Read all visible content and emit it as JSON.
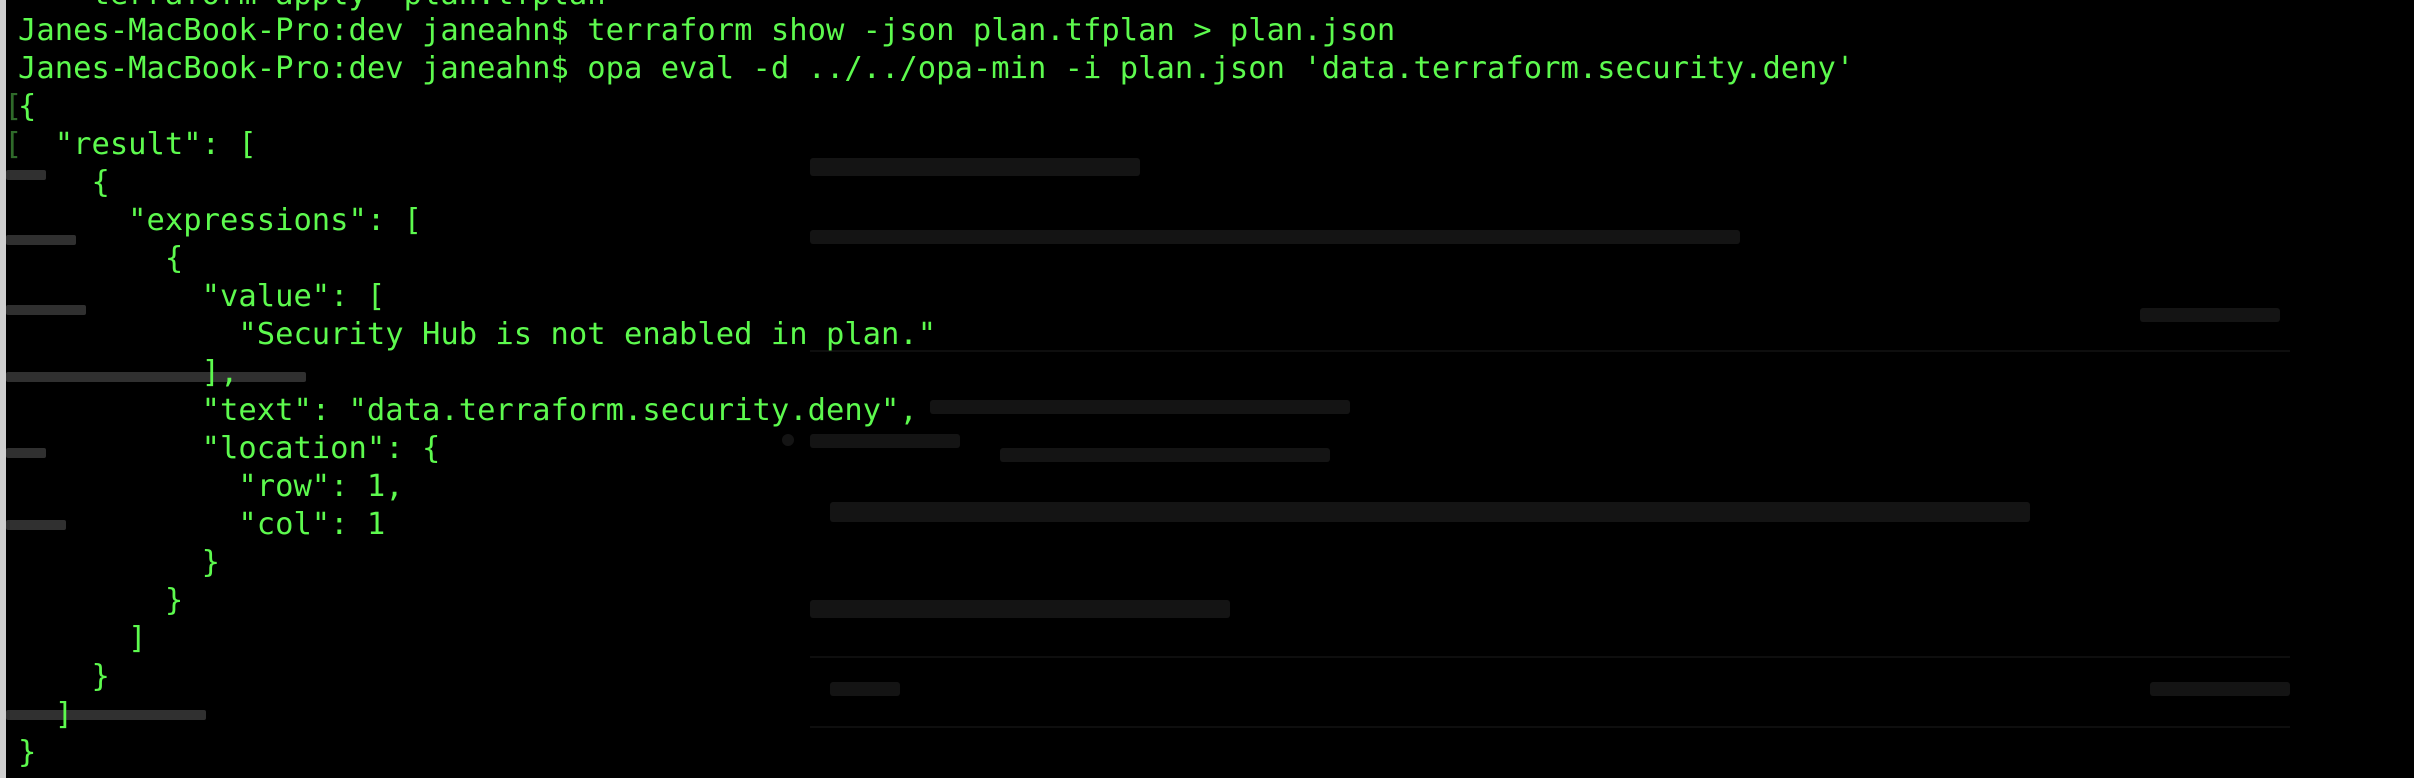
{
  "terminal": {
    "lines": {
      "l0": "    terraform apply \"plan.tfplan\"",
      "l1": "Janes-MacBook-Pro:dev janeahn$ terraform show -json plan.tfplan > plan.json",
      "l2": "Janes-MacBook-Pro:dev janeahn$ opa eval -d ../../opa-min -i plan.json 'data.terraform.security.deny'",
      "l3": "{",
      "l4": "  \"result\": [",
      "l5": "    {",
      "l6": "      \"expressions\": [",
      "l7": "        {",
      "l8": "          \"value\": [",
      "l9": "            \"Security Hub is not enabled in plan.\"",
      "l10": "          ],",
      "l11": "          \"text\": \"data.terraform.security.deny\",",
      "l12": "          \"location\": {",
      "l13": "            \"row\": 1,",
      "l14": "            \"col\": 1",
      "l15": "          }",
      "l16": "        }",
      "l17": "      ]",
      "l18": "    }",
      "l19": "  ]",
      "l20": "}"
    },
    "colors": {
      "background": "#000000",
      "text": "#5dfa4e",
      "marker": "#2f6a2a"
    }
  }
}
